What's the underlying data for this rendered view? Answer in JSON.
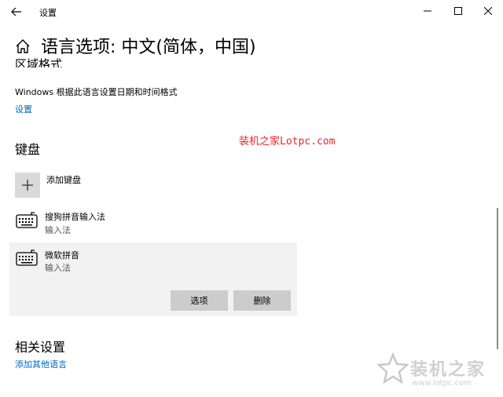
{
  "window": {
    "title": "设置"
  },
  "header": {
    "title": "语言选项: 中文(简体，中国)"
  },
  "region": {
    "title_partial": "区域格式",
    "description": "Windows 根据此语言设置日期和时间格式",
    "settings_link": "设置"
  },
  "watermark": {
    "text": "装机之家Lotpc.com"
  },
  "keyboard": {
    "title": "键盘",
    "add_label": "添加键盘",
    "items": [
      {
        "name": "搜狗拼音输入法",
        "type": "输入法"
      },
      {
        "name": "微软拼音",
        "type": "输入法"
      }
    ],
    "options_button": "选项",
    "remove_button": "删除"
  },
  "related": {
    "title": "相关设置",
    "link": "添加其他语言"
  },
  "logo": {
    "name": "装机之家",
    "url": "www.lotpc.com"
  },
  "colors": {
    "link": "#0067c0",
    "button_bg": "#cccccc",
    "selected_bg": "#f2f2f2",
    "watermark_red": "#e8262b"
  }
}
